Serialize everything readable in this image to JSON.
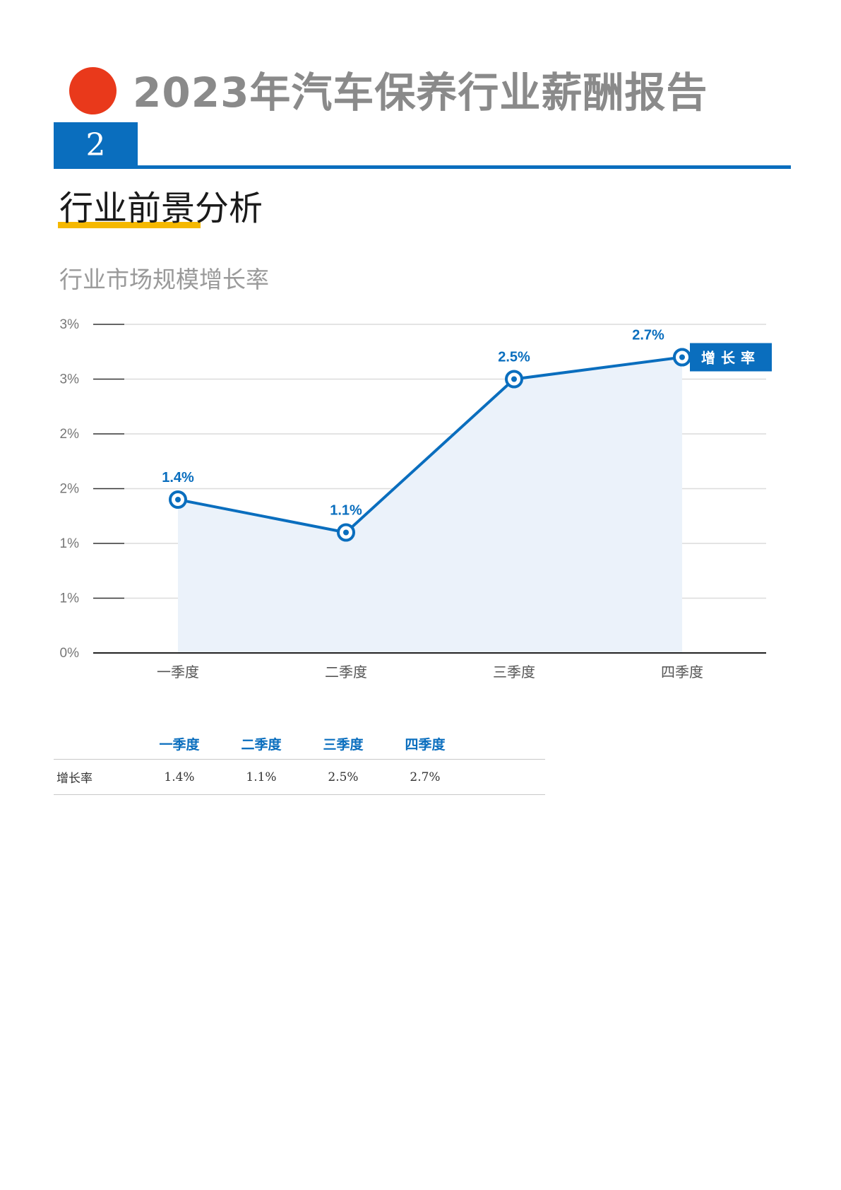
{
  "header": {
    "report_title": "2023年汽车保养行业薪酬报告",
    "chapter_number": "2",
    "section_heading": "行业前景分析",
    "accent_color": "#e9391b",
    "brand_color": "#0a6ebe",
    "underline_color": "#f5b800"
  },
  "chart_title": "行业市场规模增长率",
  "chart_data": {
    "type": "line",
    "categories": [
      "一季度",
      "二季度",
      "三季度",
      "四季度"
    ],
    "series": [
      {
        "name": "增长率",
        "values": [
          1.4,
          1.1,
          2.5,
          2.7
        ],
        "labels": [
          "1.4%",
          "1.1%",
          "2.5%",
          "2.7%"
        ],
        "color": "#0a6ebe"
      }
    ],
    "y_ticks": [
      0,
      0.5,
      1.0,
      1.5,
      2.0,
      2.5,
      3.0
    ],
    "y_tick_labels": [
      "0%",
      "1%",
      "1%",
      "2%",
      "2%",
      "3%",
      "3%"
    ],
    "ylim": [
      0,
      3.0
    ],
    "grid": true,
    "area_fill": "#ebf2fa",
    "legend_position": "right"
  },
  "table": {
    "headers": [
      "一季度",
      "二季度",
      "三季度",
      "四季度"
    ],
    "rows": [
      {
        "label": "增长率",
        "cells": [
          "1.4%",
          "1.1%",
          "2.5%",
          "2.7%"
        ]
      }
    ]
  }
}
